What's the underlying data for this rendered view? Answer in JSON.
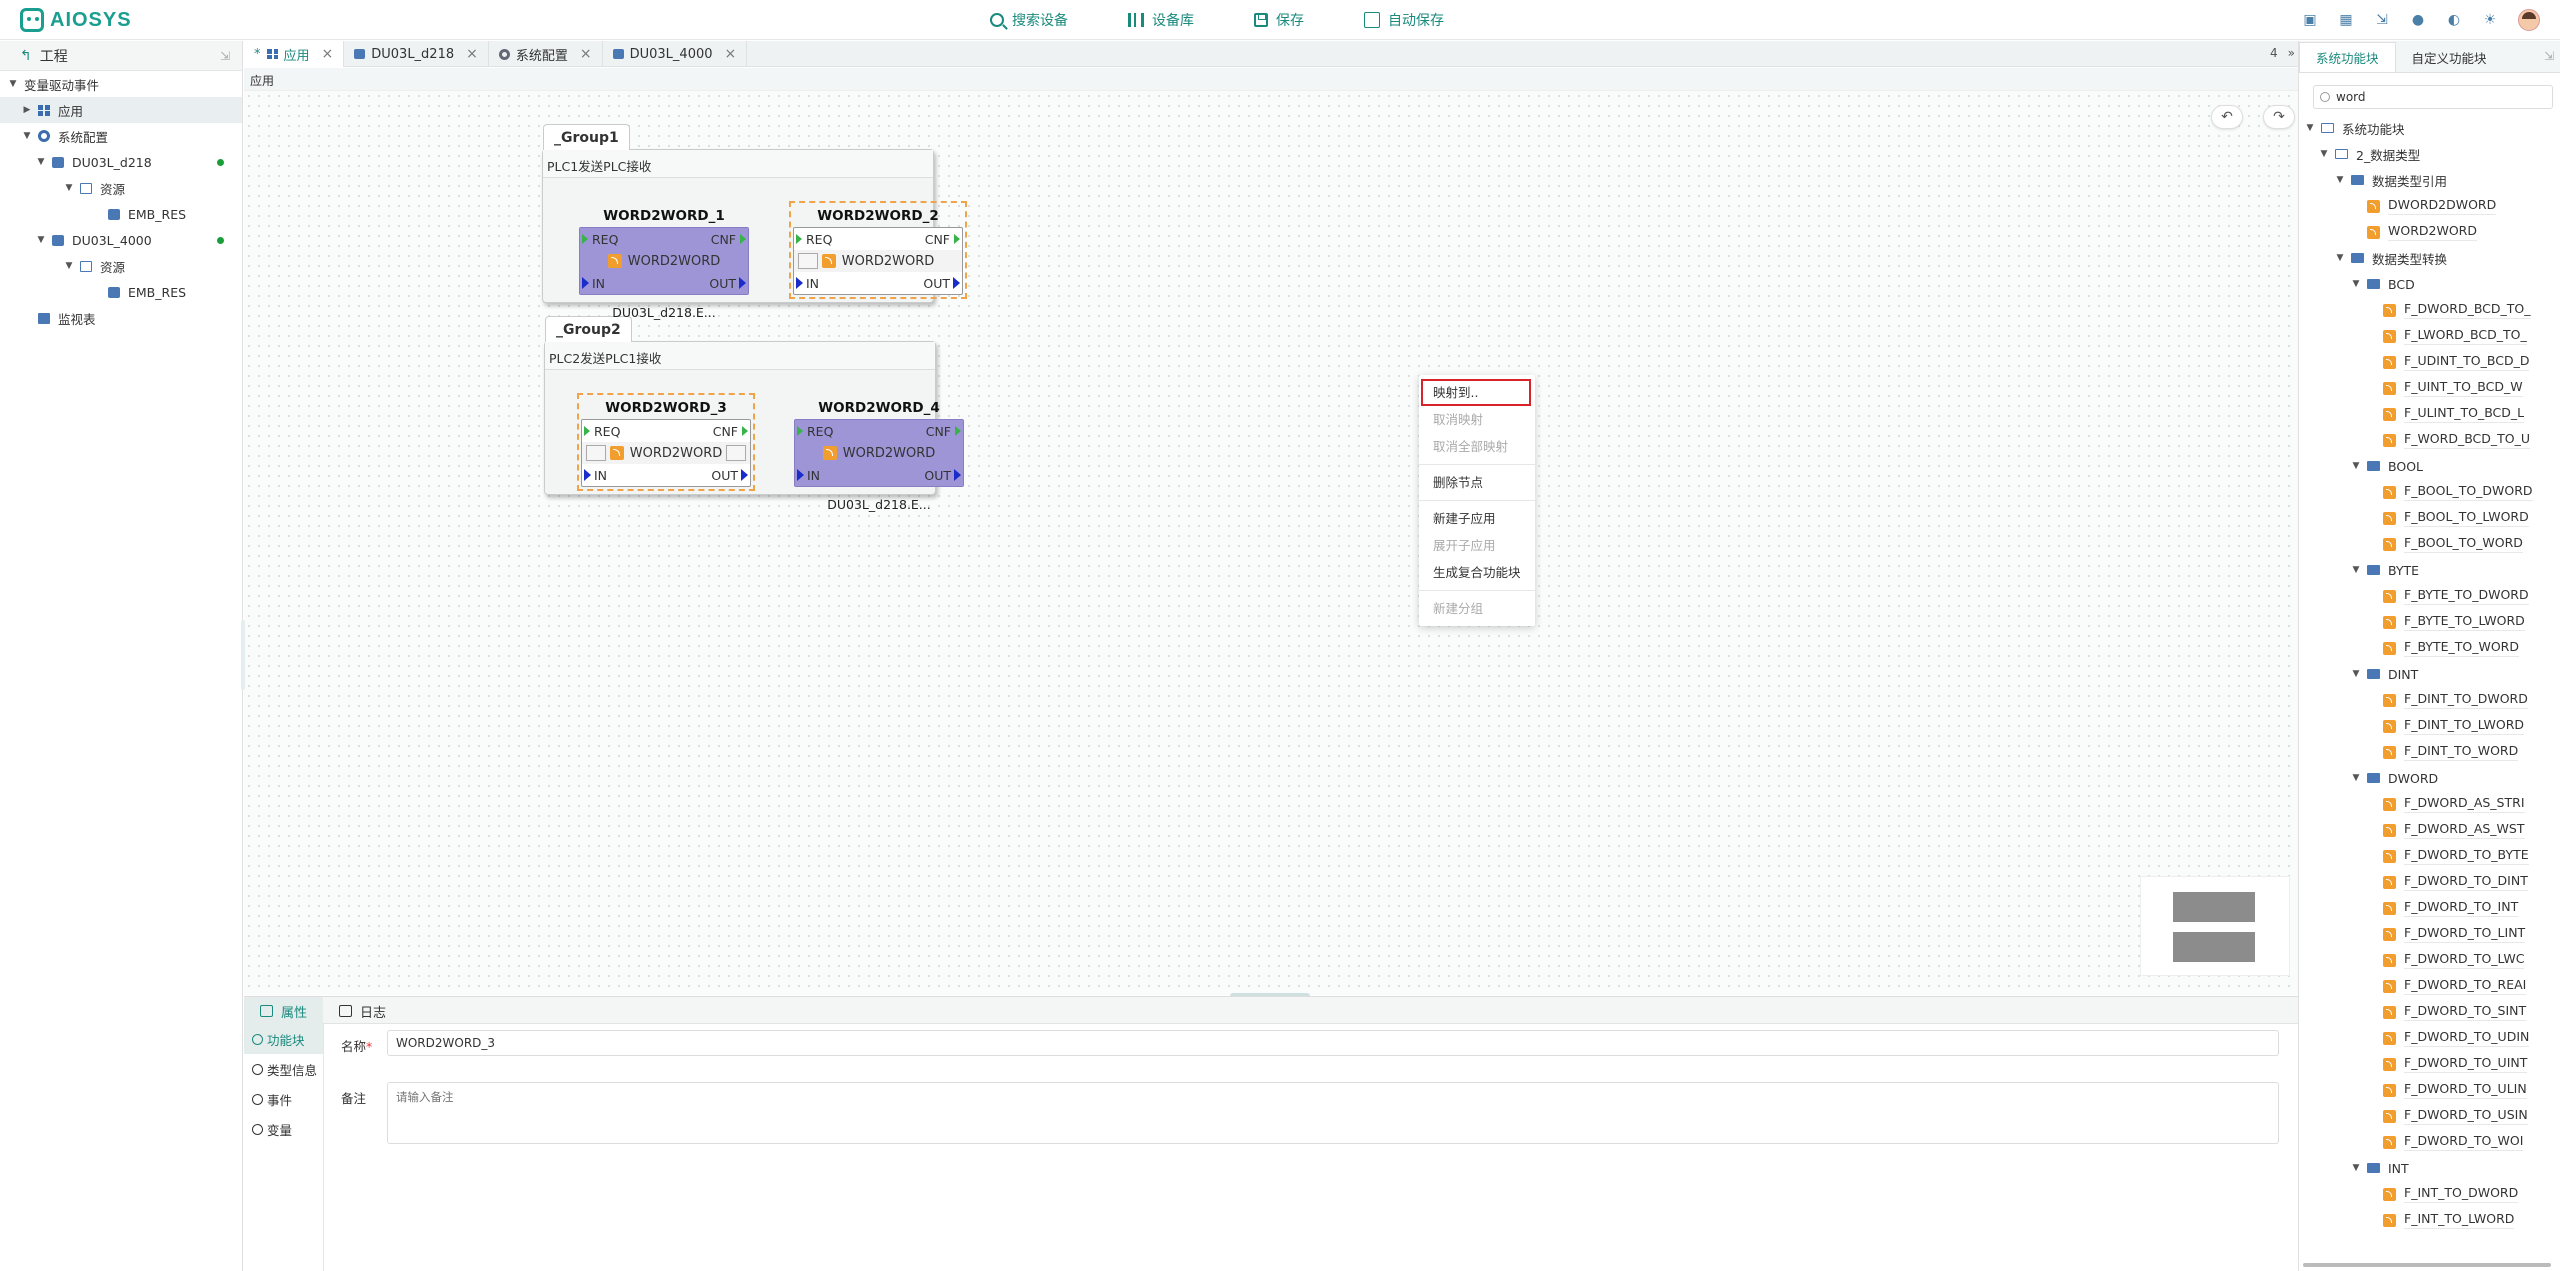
{
  "app": {
    "logo_text": "AIOSYS",
    "accent_color": "#1a8a7d"
  },
  "toolbar": {
    "search_device": "搜索设备",
    "device_library": "设备库",
    "save": "保存",
    "auto_save": "自动保存",
    "auto_save_checked": false
  },
  "top_right_icons": [
    "monitor-icon",
    "table-icon",
    "import-icon",
    "bell-icon",
    "palette-icon",
    "sun-icon",
    "user-avatar"
  ],
  "left_panel": {
    "title": "工程",
    "items": [
      {
        "label": "变量驱动事件",
        "level": 0,
        "caret": "down",
        "icon": ""
      },
      {
        "label": "应用",
        "level": 1,
        "caret": "right",
        "icon": "grid-icon",
        "selected": true
      },
      {
        "label": "系统配置",
        "level": 1,
        "caret": "down",
        "icon": "gear-icon"
      },
      {
        "label": "DU03L_d218",
        "level": 2,
        "caret": "down",
        "icon": "device-icon",
        "online": true
      },
      {
        "label": "资源",
        "level": 3,
        "caret": "down",
        "icon": "folder-icon"
      },
      {
        "label": "EMB_RES",
        "level": 4,
        "caret": "",
        "icon": "resource-icon"
      },
      {
        "label": "DU03L_4000",
        "level": 2,
        "caret": "down",
        "icon": "device-icon",
        "online": true
      },
      {
        "label": "资源",
        "level": 3,
        "caret": "down",
        "icon": "folder-icon"
      },
      {
        "label": "EMB_RES",
        "level": 4,
        "caret": "",
        "icon": "resource-icon"
      },
      {
        "label": "监视表",
        "level": 1,
        "caret": "",
        "icon": "monitor-table-icon"
      }
    ]
  },
  "tabs": [
    {
      "label": "应用",
      "modified": "*",
      "active": true,
      "icon": "grid-icon"
    },
    {
      "label": "DU03L_d218",
      "active": false,
      "icon": "device-icon"
    },
    {
      "label": "系统配置",
      "active": false,
      "icon": "gear-icon"
    },
    {
      "label": "DU03L_4000",
      "active": false,
      "icon": "device-icon"
    }
  ],
  "tabs_count": "4",
  "tabs_more": "»",
  "breadcrumb": "应用",
  "canvas": {
    "group1": {
      "name": "_Group1",
      "subtitle": "PLC1发送PLC接收"
    },
    "group2": {
      "name": "_Group2",
      "subtitle": "PLC2发送PLC1接收"
    },
    "blocks": [
      {
        "title": "WORD2WORD_1",
        "req": "REQ",
        "cnf": "CNF",
        "type": "WORD2WORD",
        "in": "IN",
        "out": "OUT",
        "caption": "DU03L_d218.E...",
        "style": "solid"
      },
      {
        "title": "WORD2WORD_2",
        "req": "REQ",
        "cnf": "CNF",
        "type": "WORD2WORD",
        "in": "IN",
        "out": "OUT",
        "caption": "",
        "style": "dashed"
      },
      {
        "title": "WORD2WORD_3",
        "req": "REQ",
        "cnf": "CNF",
        "type": "WORD2WORD",
        "in": "IN",
        "out": "OUT",
        "caption": "",
        "style": "dashed"
      },
      {
        "title": "WORD2WORD_4",
        "req": "REQ",
        "cnf": "CNF",
        "type": "WORD2WORD",
        "in": "IN",
        "out": "OUT",
        "caption": "DU03L_d218.E...",
        "style": "solid"
      }
    ],
    "undo_icon": "undo-icon",
    "redo_icon": "redo-icon"
  },
  "context_menu": [
    {
      "label": "映射到..",
      "disabled": false,
      "highlight": true
    },
    {
      "label": "取消映射",
      "disabled": true
    },
    {
      "label": "取消全部映射",
      "disabled": true
    },
    {
      "sep": true
    },
    {
      "label": "删除节点",
      "disabled": false
    },
    {
      "sep": true
    },
    {
      "label": "新建子应用",
      "disabled": false
    },
    {
      "label": "展开子应用",
      "disabled": true
    },
    {
      "label": "生成复合功能块",
      "disabled": false
    },
    {
      "sep": true
    },
    {
      "label": "新建分组",
      "disabled": true
    }
  ],
  "bottom_panel": {
    "tabs": [
      {
        "label": "属性",
        "active": true
      },
      {
        "label": "日志",
        "active": false
      }
    ],
    "side_items": [
      {
        "label": "功能块",
        "active": true
      },
      {
        "label": "类型信息",
        "active": false
      },
      {
        "label": "事件",
        "active": false
      },
      {
        "label": "变量",
        "active": false
      }
    ],
    "name_label": "名称",
    "required_mark": "*",
    "name_value": "WORD2WORD_3",
    "note_label": "备注",
    "note_placeholder": "请输入备注"
  },
  "right_panel": {
    "tabs": [
      {
        "label": "系统功能块",
        "active": true
      },
      {
        "label": "自定义功能块",
        "active": false
      }
    ],
    "search_value": "word",
    "tree": [
      {
        "label": "系统功能块",
        "level": 0,
        "type": "folder"
      },
      {
        "label": "2_数据类型",
        "level": 1,
        "type": "folder"
      },
      {
        "label": "数据类型引用",
        "level": 2,
        "type": "folder"
      },
      {
        "label": "DWORD2DWORD",
        "level": 3,
        "type": "fb"
      },
      {
        "label": "WORD2WORD",
        "level": 3,
        "type": "fb"
      },
      {
        "label": "数据类型转换",
        "level": 2,
        "type": "folder"
      },
      {
        "label": "BCD",
        "level": 3,
        "type": "folder"
      },
      {
        "label": "F_DWORD_BCD_TO_",
        "level": 4,
        "type": "fb"
      },
      {
        "label": "F_LWORD_BCD_TO_",
        "level": 4,
        "type": "fb"
      },
      {
        "label": "F_UDINT_TO_BCD_D",
        "level": 4,
        "type": "fb"
      },
      {
        "label": "F_UINT_TO_BCD_W",
        "level": 4,
        "type": "fb"
      },
      {
        "label": "F_ULINT_TO_BCD_L",
        "level": 4,
        "type": "fb"
      },
      {
        "label": "F_WORD_BCD_TO_U",
        "level": 4,
        "type": "fb"
      },
      {
        "label": "BOOL",
        "level": 3,
        "type": "folder"
      },
      {
        "label": "F_BOOL_TO_DWORD",
        "level": 4,
        "type": "fb"
      },
      {
        "label": "F_BOOL_TO_LWORD",
        "level": 4,
        "type": "fb"
      },
      {
        "label": "F_BOOL_TO_WORD",
        "level": 4,
        "type": "fb"
      },
      {
        "label": "BYTE",
        "level": 3,
        "type": "folder"
      },
      {
        "label": "F_BYTE_TO_DWORD",
        "level": 4,
        "type": "fb"
      },
      {
        "label": "F_BYTE_TO_LWORD",
        "level": 4,
        "type": "fb"
      },
      {
        "label": "F_BYTE_TO_WORD",
        "level": 4,
        "type": "fb"
      },
      {
        "label": "DINT",
        "level": 3,
        "type": "folder"
      },
      {
        "label": "F_DINT_TO_DWORD",
        "level": 4,
        "type": "fb"
      },
      {
        "label": "F_DINT_TO_LWORD",
        "level": 4,
        "type": "fb"
      },
      {
        "label": "F_DINT_TO_WORD",
        "level": 4,
        "type": "fb"
      },
      {
        "label": "DWORD",
        "level": 3,
        "type": "folder"
      },
      {
        "label": "F_DWORD_AS_STRI",
        "level": 4,
        "type": "fb"
      },
      {
        "label": "F_DWORD_AS_WST",
        "level": 4,
        "type": "fb"
      },
      {
        "label": "F_DWORD_TO_BYTE",
        "level": 4,
        "type": "fb"
      },
      {
        "label": "F_DWORD_TO_DINT",
        "level": 4,
        "type": "fb"
      },
      {
        "label": "F_DWORD_TO_INT",
        "level": 4,
        "type": "fb"
      },
      {
        "label": "F_DWORD_TO_LINT",
        "level": 4,
        "type": "fb"
      },
      {
        "label": "F_DWORD_TO_LWC",
        "level": 4,
        "type": "fb"
      },
      {
        "label": "F_DWORD_TO_REAI",
        "level": 4,
        "type": "fb"
      },
      {
        "label": "F_DWORD_TO_SINT",
        "level": 4,
        "type": "fb"
      },
      {
        "label": "F_DWORD_TO_UDIN",
        "level": 4,
        "type": "fb"
      },
      {
        "label": "F_DWORD_TO_UINT",
        "level": 4,
        "type": "fb"
      },
      {
        "label": "F_DWORD_TO_ULIN",
        "level": 4,
        "type": "fb"
      },
      {
        "label": "F_DWORD_TO_USIN",
        "level": 4,
        "type": "fb"
      },
      {
        "label": "F_DWORD_TO_WOI",
        "level": 4,
        "type": "fb"
      },
      {
        "label": "INT",
        "level": 3,
        "type": "folder"
      },
      {
        "label": "F_INT_TO_DWORD",
        "level": 4,
        "type": "fb"
      },
      {
        "label": "F_INT_TO_LWORD",
        "level": 4,
        "type": "fb"
      }
    ]
  }
}
